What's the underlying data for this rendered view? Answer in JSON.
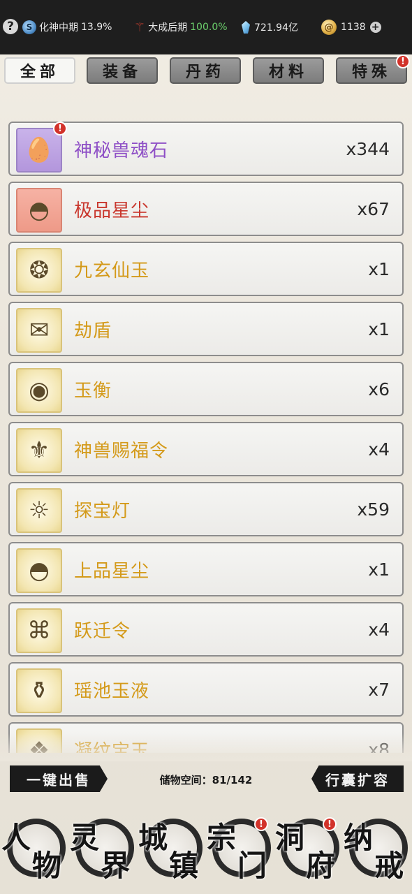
{
  "status": {
    "realm_label": "化神中期",
    "realm_pct": "13.9%",
    "cultivation_label": "大成后期",
    "cultivation_pct": "100.0%",
    "spirit_stones": "721.94亿",
    "gold": "1138"
  },
  "tabs": [
    {
      "label": "全部",
      "active": true
    },
    {
      "label": "装备",
      "active": false
    },
    {
      "label": "丹药",
      "active": false
    },
    {
      "label": "材料",
      "active": false
    },
    {
      "label": "特殊",
      "active": false
    }
  ],
  "colors": {
    "rare_purple": "#8e4fc6",
    "rare_red": "#c9372d",
    "rare_gold": "#d49a1a",
    "badge_red": "#d2322a"
  },
  "items": [
    {
      "name": "神秘兽魂石",
      "qty": "x344",
      "rarity": "purple",
      "icon": "beast-soul-egg-icon"
    },
    {
      "name": "极品星尘",
      "qty": "x67",
      "rarity": "red",
      "icon": "stardust-bowl-icon"
    },
    {
      "name": "九玄仙玉",
      "qty": "x1",
      "rarity": "gold",
      "icon": "jade-swirl-icon"
    },
    {
      "name": "劫盾",
      "qty": "x1",
      "rarity": "gold",
      "icon": "talisman-shield-icon"
    },
    {
      "name": "玉衡",
      "qty": "x6",
      "rarity": "gold",
      "icon": "jade-disc-icon"
    },
    {
      "name": "神兽赐福令",
      "qty": "x4",
      "rarity": "gold",
      "icon": "blessing-token-icon"
    },
    {
      "name": "探宝灯",
      "qty": "x59",
      "rarity": "gold",
      "icon": "treasure-lamp-icon"
    },
    {
      "name": "上品星尘",
      "qty": "x1",
      "rarity": "gold",
      "icon": "stardust-bowl-icon"
    },
    {
      "name": "跃迁令",
      "qty": "x4",
      "rarity": "gold",
      "icon": "teleport-token-icon"
    },
    {
      "name": "瑶池玉液",
      "qty": "x7",
      "rarity": "gold",
      "icon": "jade-liquid-icon"
    },
    {
      "name": "凝纹宝玉",
      "qty": "x8",
      "rarity": "gold",
      "icon": "jade-gem-icon"
    }
  ],
  "footer": {
    "sell_all": "一键出售",
    "storage_label": "储物空间：81/142",
    "expand_bag": "行囊扩容"
  },
  "nav": [
    {
      "c1": "人",
      "c2": "物",
      "badge": false
    },
    {
      "c1": "灵",
      "c2": "界",
      "badge": false
    },
    {
      "c1": "城",
      "c2": "镇",
      "badge": false
    },
    {
      "c1": "宗",
      "c2": "门",
      "badge": true
    },
    {
      "c1": "洞",
      "c2": "府",
      "badge": true
    },
    {
      "c1": "纳",
      "c2": "戒",
      "badge": false
    }
  ],
  "badge_mark": "!",
  "icons": {
    "help": "?",
    "realm_orb": "S",
    "coin": "@",
    "plus": "+"
  }
}
